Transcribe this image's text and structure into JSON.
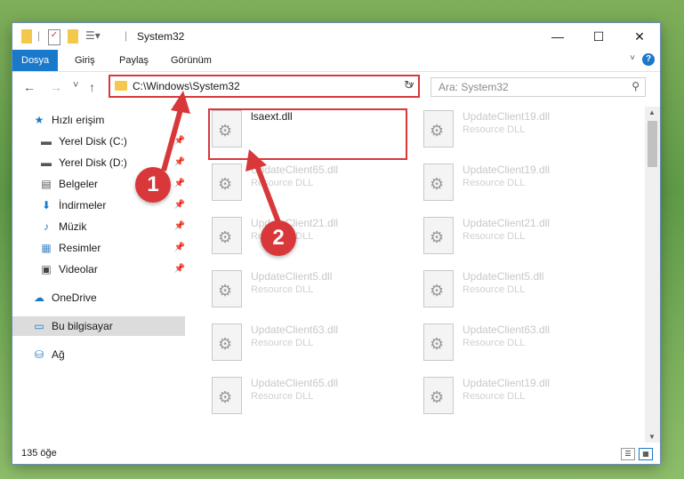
{
  "window": {
    "title": "System32"
  },
  "ribbon": {
    "tabs": [
      {
        "label": "Dosya",
        "active": true
      },
      {
        "label": "Giriş"
      },
      {
        "label": "Paylaş"
      },
      {
        "label": "Görünüm"
      }
    ],
    "help": "?"
  },
  "nav": {
    "back": "←",
    "forward": "→",
    "recent": "˅",
    "up": "↑",
    "address": "C:\\Windows\\System32",
    "refresh": "↻",
    "search_placeholder": "Ara: System32"
  },
  "sidebar": {
    "items": [
      {
        "label": "Hızlı erişim",
        "icon": "star-icon",
        "pinned": false
      },
      {
        "label": "Yerel Disk (C:)",
        "icon": "drive-icon",
        "pinned": true
      },
      {
        "label": "Yerel Disk (D:)",
        "icon": "drive-icon",
        "pinned": true
      },
      {
        "label": "Belgeler",
        "icon": "documents-icon",
        "pinned": true
      },
      {
        "label": "İndirmeler",
        "icon": "download-icon",
        "pinned": true
      },
      {
        "label": "Müzik",
        "icon": "music-icon",
        "pinned": true
      },
      {
        "label": "Resimler",
        "icon": "pictures-icon",
        "pinned": true
      },
      {
        "label": "Videolar",
        "icon": "videos-icon",
        "pinned": true
      },
      {
        "label": "OneDrive",
        "icon": "cloud-icon",
        "pinned": false
      },
      {
        "label": "Bu bilgisayar",
        "icon": "computer-icon",
        "pinned": false,
        "selected": true
      },
      {
        "label": "Ağ",
        "icon": "network-icon",
        "pinned": false
      }
    ]
  },
  "files": [
    {
      "name": "lsaext.dll",
      "type": "",
      "highlighted": true
    },
    {
      "name": "UpdateClient19.dll",
      "type": "Resource DLL"
    },
    {
      "name": "UpdateClient65.dll",
      "type": "Resource DLL"
    },
    {
      "name": "UpdateClient19.dll",
      "type": "Resource DLL"
    },
    {
      "name": "UpdateClient21.dll",
      "type": "Resource DLL"
    },
    {
      "name": "UpdateClient21.dll",
      "type": "Resource DLL"
    },
    {
      "name": "UpdateClient5.dll",
      "type": "Resource DLL"
    },
    {
      "name": "UpdateClient5.dll",
      "type": "Resource DLL"
    },
    {
      "name": "UpdateClient63.dll",
      "type": "Resource DLL"
    },
    {
      "name": "UpdateClient63.dll",
      "type": "Resource DLL"
    },
    {
      "name": "UpdateClient65.dll",
      "type": "Resource DLL"
    },
    {
      "name": "UpdateClient19.dll",
      "type": "Resource DLL"
    }
  ],
  "status": {
    "count": "135 öğe"
  },
  "annotations": {
    "step1": "1",
    "step2": "2"
  },
  "colors": {
    "accent": "#1979ca",
    "highlight": "#d9383a"
  }
}
